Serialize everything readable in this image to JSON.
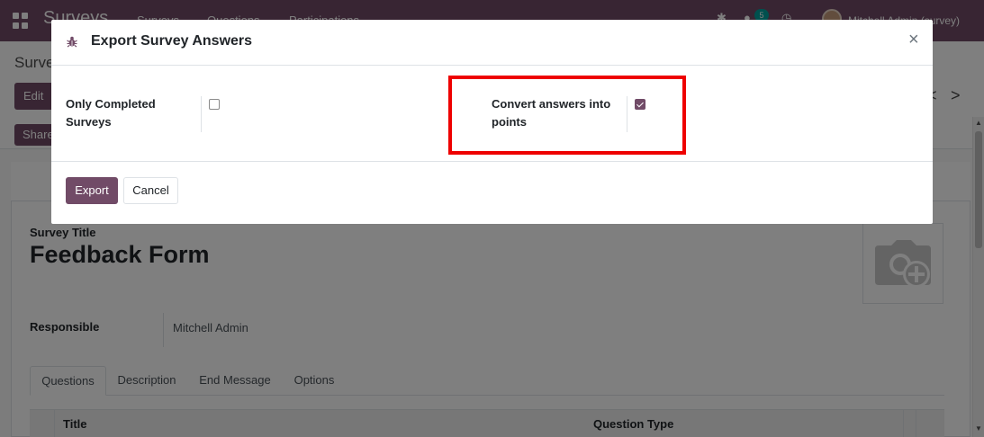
{
  "navbar": {
    "brand": "Surveys",
    "menu": [
      "Surveys",
      "Questions",
      "Participations"
    ],
    "message_count": "5",
    "user": "Mitchell Admin (survey)"
  },
  "control_panel": {
    "breadcrumb": "Surveys / Feedback Form",
    "edit_label": "Edit",
    "share_label": "Share",
    "pager_prev": "<",
    "pager_next": ">"
  },
  "form": {
    "survey_title_label": "Survey Title",
    "survey_title": "Feedback Form",
    "responsible_label": "Responsible",
    "responsible_value": "Mitchell Admin",
    "tabs": [
      "Questions",
      "Description",
      "End Message",
      "Options"
    ],
    "table_headers": [
      "Title",
      "Question Type"
    ]
  },
  "modal": {
    "title": "Export Survey Answers",
    "close_glyph": "×",
    "fields": [
      {
        "label": "Only Completed Surveys",
        "checked": false
      },
      {
        "label": "Convert answers into points",
        "checked": true
      }
    ],
    "export_label": "Export",
    "cancel_label": "Cancel"
  },
  "colors": {
    "brand": "#714b67",
    "highlight": "#ee0000"
  }
}
